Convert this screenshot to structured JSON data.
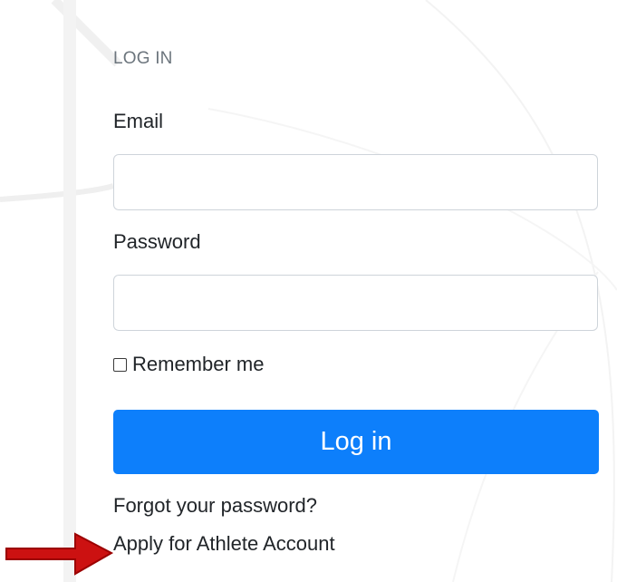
{
  "login": {
    "section_title": "LOG IN",
    "email_label": "Email",
    "email_value": "",
    "password_label": "Password",
    "password_value": "",
    "remember_label": "Remember me",
    "submit_label": "Log in",
    "forgot_link": "Forgot your password?",
    "apply_link": "Apply for Athlete Account"
  },
  "annotation": {
    "arrow_icon": "arrow-right-icon",
    "arrow_color": "#cc1111"
  },
  "colors": {
    "primary": "#0d7ffb",
    "muted": "#6c757d",
    "text": "#212529"
  }
}
